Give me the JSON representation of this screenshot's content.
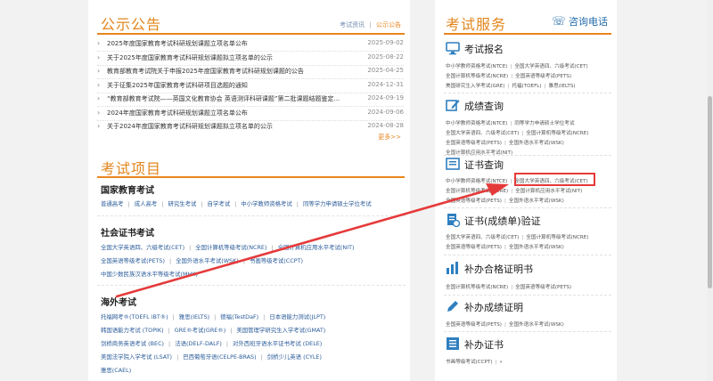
{
  "announcements": {
    "title": "公示公告",
    "tab_exam_news": "考试资讯",
    "tab_divider": "|",
    "tab_notices": "公示公告",
    "items": [
      {
        "text": "2025年度国家教育考试科研规划课题立项名单公布",
        "date": "2025-09-02"
      },
      {
        "text": "关于2025年度国家教育考试科研规划课题拟立项名单的公示",
        "date": "2025-08-22"
      },
      {
        "text": "教育部教育考试院关于申报2025年度国家教育考试科研规划课题的公告",
        "date": "2025-04-25"
      },
      {
        "text": "关于征集2025年国家教育考试科研项目选题的通知",
        "date": "2024-12-31"
      },
      {
        "text": "“教育部教育考试院——英国文化教育协会 英语测评科研课题”第二批课题结题鉴定...",
        "date": "2024-09-19"
      },
      {
        "text": "2024年度国家教育考试科研规划课题立项名单公布",
        "date": "2024-09-06"
      },
      {
        "text": "关于2024年度国家教育考试科研规划课题拟立项名单的公示",
        "date": "2024-08-28"
      }
    ],
    "more": "更多>>"
  },
  "exam_items": {
    "title": "考试项目",
    "national": {
      "title": "国家教育考试",
      "row1": [
        "普通高考",
        "成人高考",
        "研究生考试",
        "自学考试",
        "中小学教师资格考试",
        "同等学力申请硕士学位考试"
      ]
    },
    "social": {
      "title": "社会证书考试",
      "row1": [
        "全国大学英语四、六级考试(CET)",
        "全国计算机等级考试(NCRE)",
        "全国计算机应用水平考试(NIT)"
      ],
      "row2": [
        "全国英语等级考试(PETS)",
        "全国外语水平考试(WSK)",
        "书画等级考试(CCPT)"
      ],
      "row3": [
        "中国少数民族汉语水平等级考试(MHK)"
      ]
    },
    "overseas": {
      "title": "海外考试",
      "row1": [
        "托福网考®(TOEFL iBT®)",
        "雅思(IELTS)",
        "德福(TestDaF)",
        "日本语能力测试(JLPT)"
      ],
      "row2": [
        "韩国语能力考试 (TOPIK)",
        "GRE®考试(GRE®)",
        "美国管理学研究生入学考试(GMAT)"
      ],
      "row3": [
        "剑桥商务英语考试 (BEC)",
        "法语(DELF-DALF)",
        "对外西班牙语水平证书考试 (DELE)"
      ],
      "row4": [
        "美国法学院入学考试 (LSAT)",
        "巴西葡萄牙语(CELPE-BRAS)",
        "剑桥少儿英语 (CYLE)"
      ],
      "row5": [
        "雅思(CAEL)"
      ]
    }
  },
  "services": {
    "title": "考试服务",
    "phone": "咨询电话",
    "registration": {
      "title": "考试报名",
      "lines": [
        [
          "中小学教师资格考试(NTCE)",
          "全国大学英语四、六级考试(CET)"
        ],
        [
          "全国计算机等级考试(NCRE)",
          "全国英语等级考试(PETS)"
        ],
        [
          "美国研究生入学考试(GRE)",
          "托福(TOEFL)",
          "雅思(IELTS)"
        ]
      ]
    },
    "score_query": {
      "title": "成绩查询",
      "lines": [
        [
          "中小学教师资格考试(NTCE)",
          "同等学力申请硕士学位考试"
        ],
        [
          "全国大学英语四、六级考试(CET)",
          "全国计算机等级考试(NCRE)"
        ],
        [
          "全国英语等级考试(PETS)",
          "全国外语水平考试(WSK)"
        ],
        [
          "全国计算机应用水平考试(NIT)"
        ]
      ]
    },
    "cert_query": {
      "title": "证书查询",
      "lines": [
        [
          "中小学教师资格考试(NTCE)",
          "全国大学英语四、六级考试(CET)"
        ],
        [
          "全国计算机等级考试(NCRE)",
          "全国计算机应用水平考试(NIT)"
        ],
        [
          "全国英语等级考试(PETS)",
          "全国外语水平考试(WSK)"
        ]
      ]
    },
    "cert_verify": {
      "title": "证书(成绩单)验证",
      "lines": [
        [
          "全国大学英语四、六级考试(CET)",
          "全国计算机等级考试(NCRE)"
        ],
        [
          "全国英语等级考试(PETS)",
          "全国外语水平考试(WSK)"
        ]
      ]
    },
    "cert_proof": {
      "title": "补办合格证明书",
      "lines": [
        [
          "全国计算机等级考试(NCRE)",
          "全国英语等级考试(PETS)"
        ]
      ]
    },
    "score_proof": {
      "title": "补办成绩证明",
      "lines": [
        [
          "全国英语等级考试(PETS)",
          "全国外语水平考试(WSK)"
        ]
      ]
    },
    "reissue": {
      "title": "补办证书",
      "lines": [
        [
          "书画等级考试(CCPT)",
          "»"
        ]
      ]
    }
  },
  "colors": {
    "accent_orange": "#e8861f",
    "link_blue": "#2b5c9a",
    "annotation_red": "#e53a3a"
  }
}
